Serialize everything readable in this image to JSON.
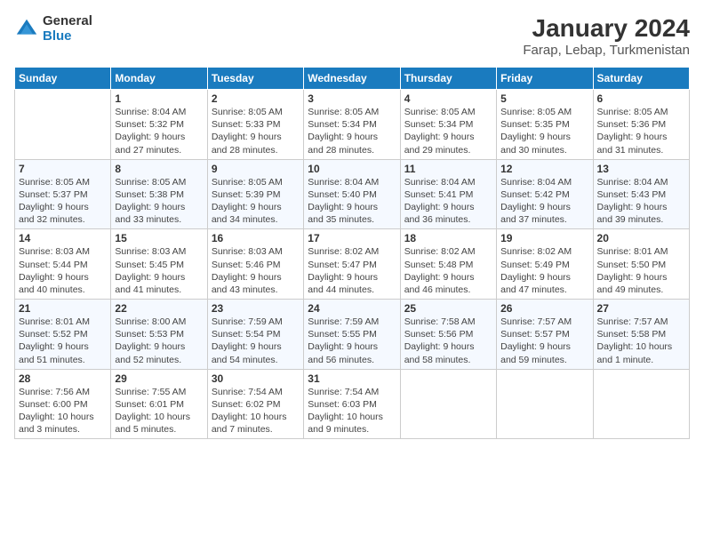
{
  "logo": {
    "line1": "General",
    "line2": "Blue"
  },
  "title": "January 2024",
  "subtitle": "Farap, Lebap, Turkmenistan",
  "weekdays": [
    "Sunday",
    "Monday",
    "Tuesday",
    "Wednesday",
    "Thursday",
    "Friday",
    "Saturday"
  ],
  "weeks": [
    [
      {
        "day": "",
        "detail": ""
      },
      {
        "day": "1",
        "detail": "Sunrise: 8:04 AM\nSunset: 5:32 PM\nDaylight: 9 hours\nand 27 minutes."
      },
      {
        "day": "2",
        "detail": "Sunrise: 8:05 AM\nSunset: 5:33 PM\nDaylight: 9 hours\nand 28 minutes."
      },
      {
        "day": "3",
        "detail": "Sunrise: 8:05 AM\nSunset: 5:34 PM\nDaylight: 9 hours\nand 28 minutes."
      },
      {
        "day": "4",
        "detail": "Sunrise: 8:05 AM\nSunset: 5:34 PM\nDaylight: 9 hours\nand 29 minutes."
      },
      {
        "day": "5",
        "detail": "Sunrise: 8:05 AM\nSunset: 5:35 PM\nDaylight: 9 hours\nand 30 minutes."
      },
      {
        "day": "6",
        "detail": "Sunrise: 8:05 AM\nSunset: 5:36 PM\nDaylight: 9 hours\nand 31 minutes."
      }
    ],
    [
      {
        "day": "7",
        "detail": "Sunrise: 8:05 AM\nSunset: 5:37 PM\nDaylight: 9 hours\nand 32 minutes."
      },
      {
        "day": "8",
        "detail": "Sunrise: 8:05 AM\nSunset: 5:38 PM\nDaylight: 9 hours\nand 33 minutes."
      },
      {
        "day": "9",
        "detail": "Sunrise: 8:05 AM\nSunset: 5:39 PM\nDaylight: 9 hours\nand 34 minutes."
      },
      {
        "day": "10",
        "detail": "Sunrise: 8:04 AM\nSunset: 5:40 PM\nDaylight: 9 hours\nand 35 minutes."
      },
      {
        "day": "11",
        "detail": "Sunrise: 8:04 AM\nSunset: 5:41 PM\nDaylight: 9 hours\nand 36 minutes."
      },
      {
        "day": "12",
        "detail": "Sunrise: 8:04 AM\nSunset: 5:42 PM\nDaylight: 9 hours\nand 37 minutes."
      },
      {
        "day": "13",
        "detail": "Sunrise: 8:04 AM\nSunset: 5:43 PM\nDaylight: 9 hours\nand 39 minutes."
      }
    ],
    [
      {
        "day": "14",
        "detail": "Sunrise: 8:03 AM\nSunset: 5:44 PM\nDaylight: 9 hours\nand 40 minutes."
      },
      {
        "day": "15",
        "detail": "Sunrise: 8:03 AM\nSunset: 5:45 PM\nDaylight: 9 hours\nand 41 minutes."
      },
      {
        "day": "16",
        "detail": "Sunrise: 8:03 AM\nSunset: 5:46 PM\nDaylight: 9 hours\nand 43 minutes."
      },
      {
        "day": "17",
        "detail": "Sunrise: 8:02 AM\nSunset: 5:47 PM\nDaylight: 9 hours\nand 44 minutes."
      },
      {
        "day": "18",
        "detail": "Sunrise: 8:02 AM\nSunset: 5:48 PM\nDaylight: 9 hours\nand 46 minutes."
      },
      {
        "day": "19",
        "detail": "Sunrise: 8:02 AM\nSunset: 5:49 PM\nDaylight: 9 hours\nand 47 minutes."
      },
      {
        "day": "20",
        "detail": "Sunrise: 8:01 AM\nSunset: 5:50 PM\nDaylight: 9 hours\nand 49 minutes."
      }
    ],
    [
      {
        "day": "21",
        "detail": "Sunrise: 8:01 AM\nSunset: 5:52 PM\nDaylight: 9 hours\nand 51 minutes."
      },
      {
        "day": "22",
        "detail": "Sunrise: 8:00 AM\nSunset: 5:53 PM\nDaylight: 9 hours\nand 52 minutes."
      },
      {
        "day": "23",
        "detail": "Sunrise: 7:59 AM\nSunset: 5:54 PM\nDaylight: 9 hours\nand 54 minutes."
      },
      {
        "day": "24",
        "detail": "Sunrise: 7:59 AM\nSunset: 5:55 PM\nDaylight: 9 hours\nand 56 minutes."
      },
      {
        "day": "25",
        "detail": "Sunrise: 7:58 AM\nSunset: 5:56 PM\nDaylight: 9 hours\nand 58 minutes."
      },
      {
        "day": "26",
        "detail": "Sunrise: 7:57 AM\nSunset: 5:57 PM\nDaylight: 9 hours\nand 59 minutes."
      },
      {
        "day": "27",
        "detail": "Sunrise: 7:57 AM\nSunset: 5:58 PM\nDaylight: 10 hours\nand 1 minute."
      }
    ],
    [
      {
        "day": "28",
        "detail": "Sunrise: 7:56 AM\nSunset: 6:00 PM\nDaylight: 10 hours\nand 3 minutes."
      },
      {
        "day": "29",
        "detail": "Sunrise: 7:55 AM\nSunset: 6:01 PM\nDaylight: 10 hours\nand 5 minutes."
      },
      {
        "day": "30",
        "detail": "Sunrise: 7:54 AM\nSunset: 6:02 PM\nDaylight: 10 hours\nand 7 minutes."
      },
      {
        "day": "31",
        "detail": "Sunrise: 7:54 AM\nSunset: 6:03 PM\nDaylight: 10 hours\nand 9 minutes."
      },
      {
        "day": "",
        "detail": ""
      },
      {
        "day": "",
        "detail": ""
      },
      {
        "day": "",
        "detail": ""
      }
    ]
  ]
}
